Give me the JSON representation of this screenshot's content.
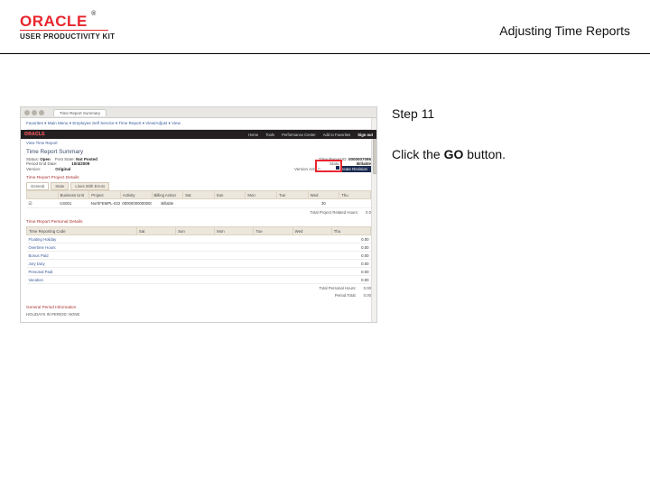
{
  "header": {
    "brand": "ORACLE",
    "upk": "USER PRODUCTIVITY KIT",
    "page_title": "Adjusting Time Reports"
  },
  "instructions": {
    "step": "Step 11",
    "text_before": "Click the ",
    "bold": "GO",
    "text_after": " button."
  },
  "shot": {
    "browser_tab": "Time Report Summary",
    "menu_line": "Favorites ▾   Main Menu ▾   Employee Self Service ▾   Time Report ▾   View/Adjust ▾   View",
    "brandbar_logo": "ORACLE",
    "brandbar_nav": [
      "Home",
      "Tools",
      "Performance Center",
      "Add to Favorites",
      "Sign out"
    ],
    "breadcrumb": "View Time Report",
    "page_hdr": "Time Report Summary",
    "status_lbl": "Status:",
    "status_val": "Open",
    "post_lbl": "Post State:",
    "post_val": "Not Posted",
    "report_id_lbl": "Time Report ID:",
    "report_id_val": "0000007095",
    "period_lbl": "Period End Date:",
    "period_val": "10/4/2009",
    "billable_status_lbl": "Status:",
    "billable_status_val": "Billable",
    "version_lbl": "Version:",
    "version_val": "Original",
    "action_lbl": "Version Action:",
    "action_val": "Create Revision",
    "callout_hidden_button": "GO",
    "sec1": "Time Report Project Details",
    "tabs": [
      "General",
      "State",
      "Lines With Errors"
    ],
    "tbl1": {
      "headers": [
        "",
        "Business Unit",
        "Project",
        "Activity",
        "Billing Action",
        "Sat",
        "Sun",
        "Mon",
        "Tue",
        "Wed",
        "Thu"
      ],
      "row": [
        "☑",
        "US001",
        "North*EMPL-022005",
        "000000000000001",
        "Billable",
        "",
        "",
        "",
        "",
        "30",
        ""
      ]
    },
    "totals1_lbl": "Total Project Related Hours:",
    "totals1_val": "0.0",
    "sec2": "Time Report Personal Details",
    "tbl2": {
      "headers": [
        "Time Reporting Code",
        "Sat",
        "Sun",
        "Mon",
        "Tue",
        "Wed",
        "Thu"
      ],
      "rows": [
        [
          "Floating Holiday",
          "",
          "",
          "",
          "",
          "",
          "0.00"
        ],
        [
          "Overtime Hours",
          "",
          "",
          "",
          "",
          "",
          "0.00"
        ],
        [
          "Bonus Paid",
          "",
          "",
          "",
          "",
          "",
          "0.00"
        ],
        [
          "Jury Duty",
          "",
          "",
          "",
          "",
          "",
          "0.00"
        ],
        [
          "Personal Paid",
          "",
          "",
          "",
          "",
          "",
          "0.00"
        ],
        [
          "Vacation",
          "",
          "",
          "",
          "",
          "",
          "0.00"
        ]
      ]
    },
    "totals2_lbl1": "Total Personal Hours:",
    "totals2_val1": "0.00",
    "totals2_lbl2": "Period Total:",
    "totals2_val2": "0.00",
    "period_info": "General Period Information",
    "holiday": "HOLIDAYS IN PERIOD: NONE"
  }
}
